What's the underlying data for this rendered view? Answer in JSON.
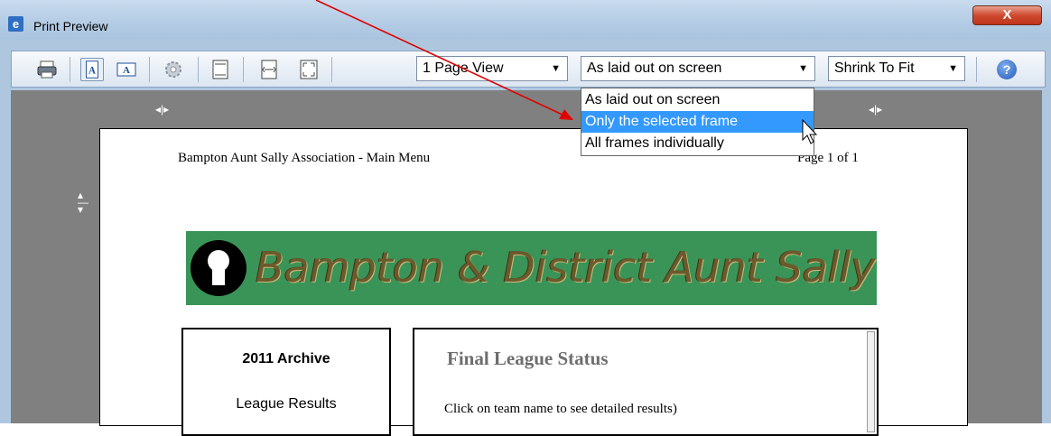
{
  "window": {
    "title": "Print Preview",
    "close_label": "X"
  },
  "toolbar": {
    "page_view": "1 Page View",
    "frames_selected": "As laid out on screen",
    "scale": "Shrink To Fit",
    "help_label": "?"
  },
  "dropdown": {
    "options": [
      "As laid out on screen",
      "Only the selected frame",
      "All frames individually"
    ],
    "selected": "Only the selected frame"
  },
  "page": {
    "header_left": "Bampton Aunt Sally Association - Main Menu",
    "header_right": "Page 1 of 1",
    "banner_text": "Bampton & District Aunt Sally A",
    "nav": [
      "2011 Archive",
      "League Results"
    ],
    "content_title": "Final League Status",
    "content_text": "Click on team name to see detailed results)"
  },
  "colors": {
    "selection": "#3399ff",
    "annotation_arrow": "#e00000",
    "banner": "#3a9457",
    "preview_background": "#808080"
  }
}
